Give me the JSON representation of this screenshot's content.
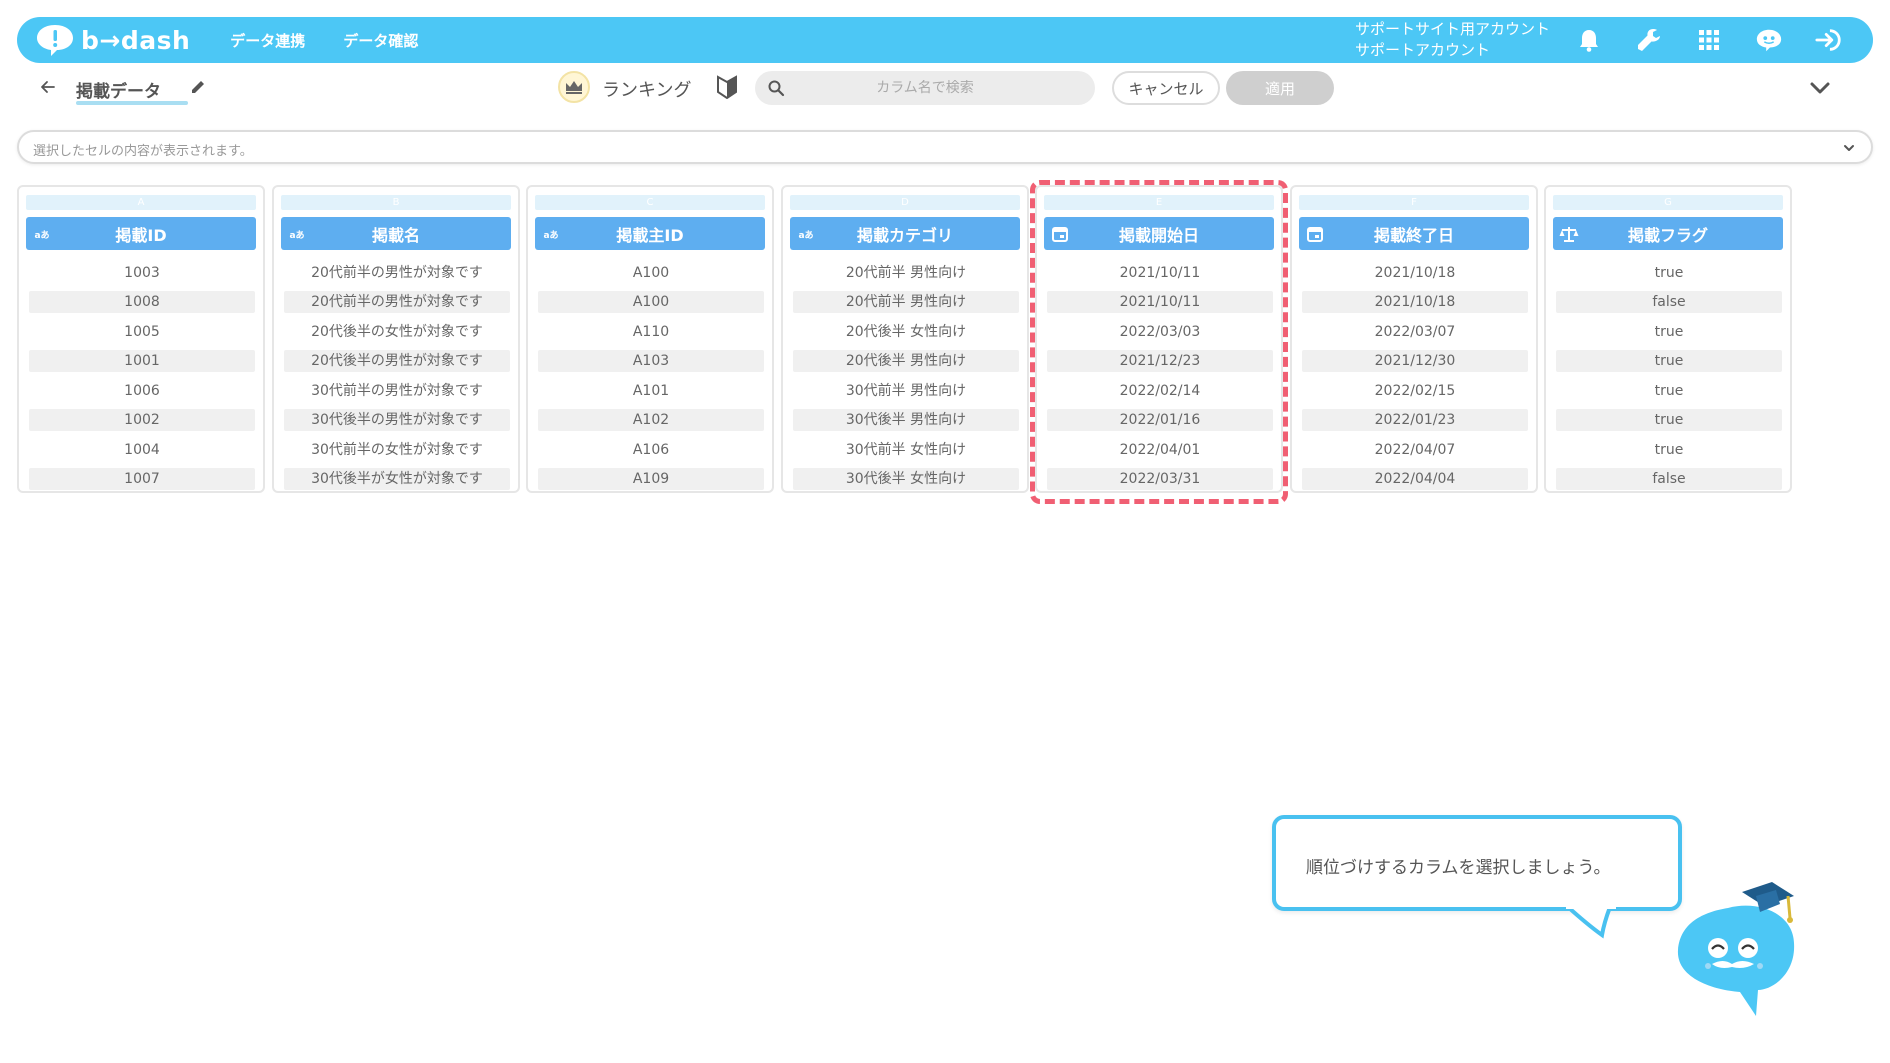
{
  "header": {
    "logo_text": "b→dash",
    "nav": [
      "データ連携",
      "データ確認"
    ],
    "account_line1": "サポートサイト用アカウント",
    "account_line2": "サポートアカウント",
    "icons": [
      "bell-icon",
      "wrench-icon",
      "grid-icon",
      "support-icon",
      "logout-icon"
    ],
    "accent_color": "#4cc7f5"
  },
  "toolbar": {
    "page_title": "掲載データ",
    "ranking_label": "ランキング",
    "search_placeholder": "カラム名で検索",
    "cancel_label": "キャンセル",
    "apply_label": "適用"
  },
  "cell_bar": {
    "placeholder": "選択したセルの内容が表示されます。"
  },
  "columns": [
    {
      "letter": "A",
      "type": "text",
      "name": "掲載ID",
      "cells": [
        "1003",
        "1008",
        "1005",
        "1001",
        "1006",
        "1002",
        "1004",
        "1007"
      ]
    },
    {
      "letter": "B",
      "type": "text",
      "name": "掲載名",
      "cells": [
        "20代前半の男性が対象です",
        "20代前半の男性が対象です",
        "20代後半の女性が対象です",
        "20代後半の男性が対象です",
        "30代前半の男性が対象です",
        "30代後半の男性が対象です",
        "30代前半の女性が対象です",
        "30代後半が女性が対象です"
      ]
    },
    {
      "letter": "C",
      "type": "text",
      "name": "掲載主ID",
      "cells": [
        "A100",
        "A100",
        "A110",
        "A103",
        "A101",
        "A102",
        "A106",
        "A109"
      ]
    },
    {
      "letter": "D",
      "type": "text",
      "name": "掲載カテゴリ",
      "cells": [
        "20代前半 男性向け",
        "20代前半 男性向け",
        "20代後半 女性向け",
        "20代後半 男性向け",
        "30代前半 男性向け",
        "30代後半 男性向け",
        "30代前半 女性向け",
        "30代後半 女性向け"
      ]
    },
    {
      "letter": "E",
      "type": "date",
      "name": "掲載開始日",
      "cells": [
        "2021/10/11",
        "2021/10/11",
        "2022/03/03",
        "2021/12/23",
        "2022/02/14",
        "2022/01/16",
        "2022/04/01",
        "2022/03/31"
      ]
    },
    {
      "letter": "F",
      "type": "date",
      "name": "掲載終了日",
      "cells": [
        "2021/10/18",
        "2021/10/18",
        "2022/03/07",
        "2021/12/30",
        "2022/02/15",
        "2022/01/23",
        "2022/04/07",
        "2022/04/04"
      ]
    },
    {
      "letter": "G",
      "type": "flag",
      "name": "掲載フラグ",
      "cells": [
        "true",
        "false",
        "true",
        "true",
        "true",
        "true",
        "true",
        "false"
      ]
    }
  ],
  "type_labels": {
    "text": "aあ"
  },
  "highlight_column": "E",
  "hint": {
    "text": "順位づけするカラムを選択しましょう。"
  }
}
